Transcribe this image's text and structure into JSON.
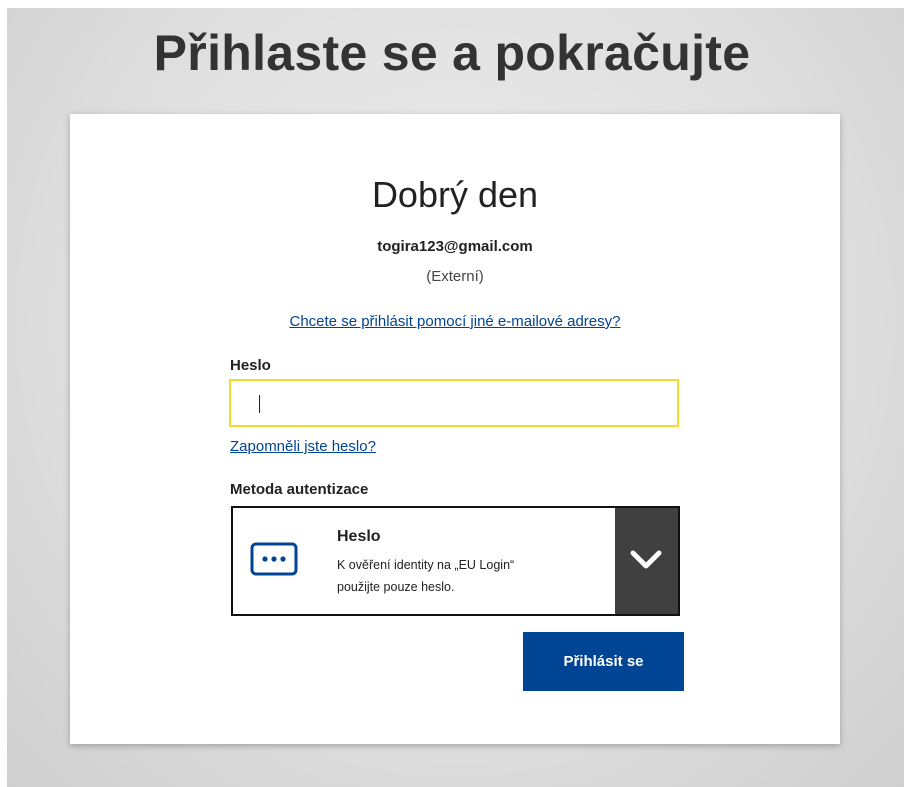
{
  "header": {
    "title": "Přihlaste se a pokračujte"
  },
  "card": {
    "greeting": "Dobrý den",
    "email": "togira123@gmail.com",
    "account_type": "(Externí)",
    "switch_account_link": "Chcete se přihlásit pomocí jiné e-mailové adresy?",
    "password": {
      "label": "Heslo",
      "value": "",
      "forgot_link": "Zapomněli jste heslo?"
    },
    "auth_method": {
      "label": "Metoda autentizace",
      "selected_title": "Heslo",
      "selected_description_line1": "K ověření identity na „EU Login“",
      "selected_description_line2": "použijte pouze heslo.",
      "icon": "password-dots-icon",
      "toggle_icon": "chevron-down-icon"
    },
    "submit_label": "Přihlásit se"
  },
  "colors": {
    "primary": "#004494",
    "input_focus_border": "#f8d82a",
    "toggle_bg": "#404040",
    "title_text": "#333333"
  }
}
